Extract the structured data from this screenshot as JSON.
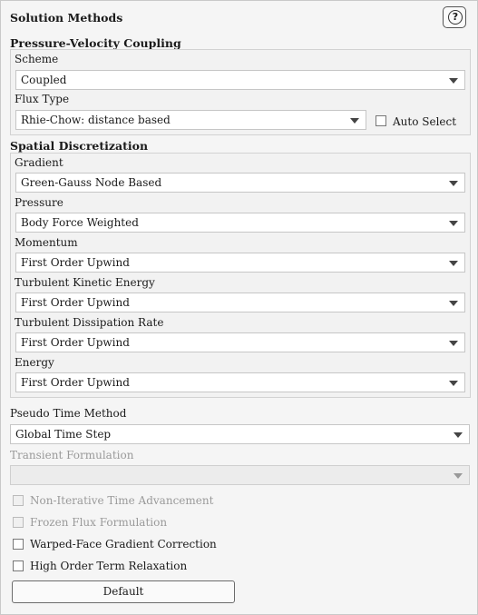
{
  "panel": {
    "title": "Solution Methods",
    "help_icon": "question-circle-icon",
    "help_glyph": "?"
  },
  "pvc": {
    "heading": "Pressure-Velocity Coupling",
    "scheme_label": "Scheme",
    "scheme_value": "Coupled",
    "flux_label": "Flux Type",
    "flux_value": "Rhie-Chow: distance based",
    "auto_select_label": "Auto Select",
    "auto_select_checked": false
  },
  "spatial": {
    "heading": "Spatial Discretization",
    "items": [
      {
        "label": "Gradient",
        "value": "Green-Gauss Node Based"
      },
      {
        "label": "Pressure",
        "value": "Body Force Weighted"
      },
      {
        "label": "Momentum",
        "value": "First Order Upwind"
      },
      {
        "label": "Turbulent Kinetic Energy",
        "value": "First Order Upwind"
      },
      {
        "label": "Turbulent Dissipation Rate",
        "value": "First Order Upwind"
      },
      {
        "label": "Energy",
        "value": "First Order Upwind"
      }
    ]
  },
  "pseudo": {
    "label": "Pseudo Time Method",
    "value": "Global Time Step"
  },
  "transient": {
    "label": "Transient Formulation",
    "value": "",
    "disabled": true
  },
  "options": [
    {
      "label": "Non-Iterative Time Advancement",
      "checked": false,
      "disabled": true
    },
    {
      "label": "Frozen Flux Formulation",
      "checked": false,
      "disabled": true
    },
    {
      "label": "Warped-Face Gradient Correction",
      "checked": false,
      "disabled": false
    },
    {
      "label": "High Order Term Relaxation",
      "checked": false,
      "disabled": false
    }
  ],
  "default_button": "Default"
}
